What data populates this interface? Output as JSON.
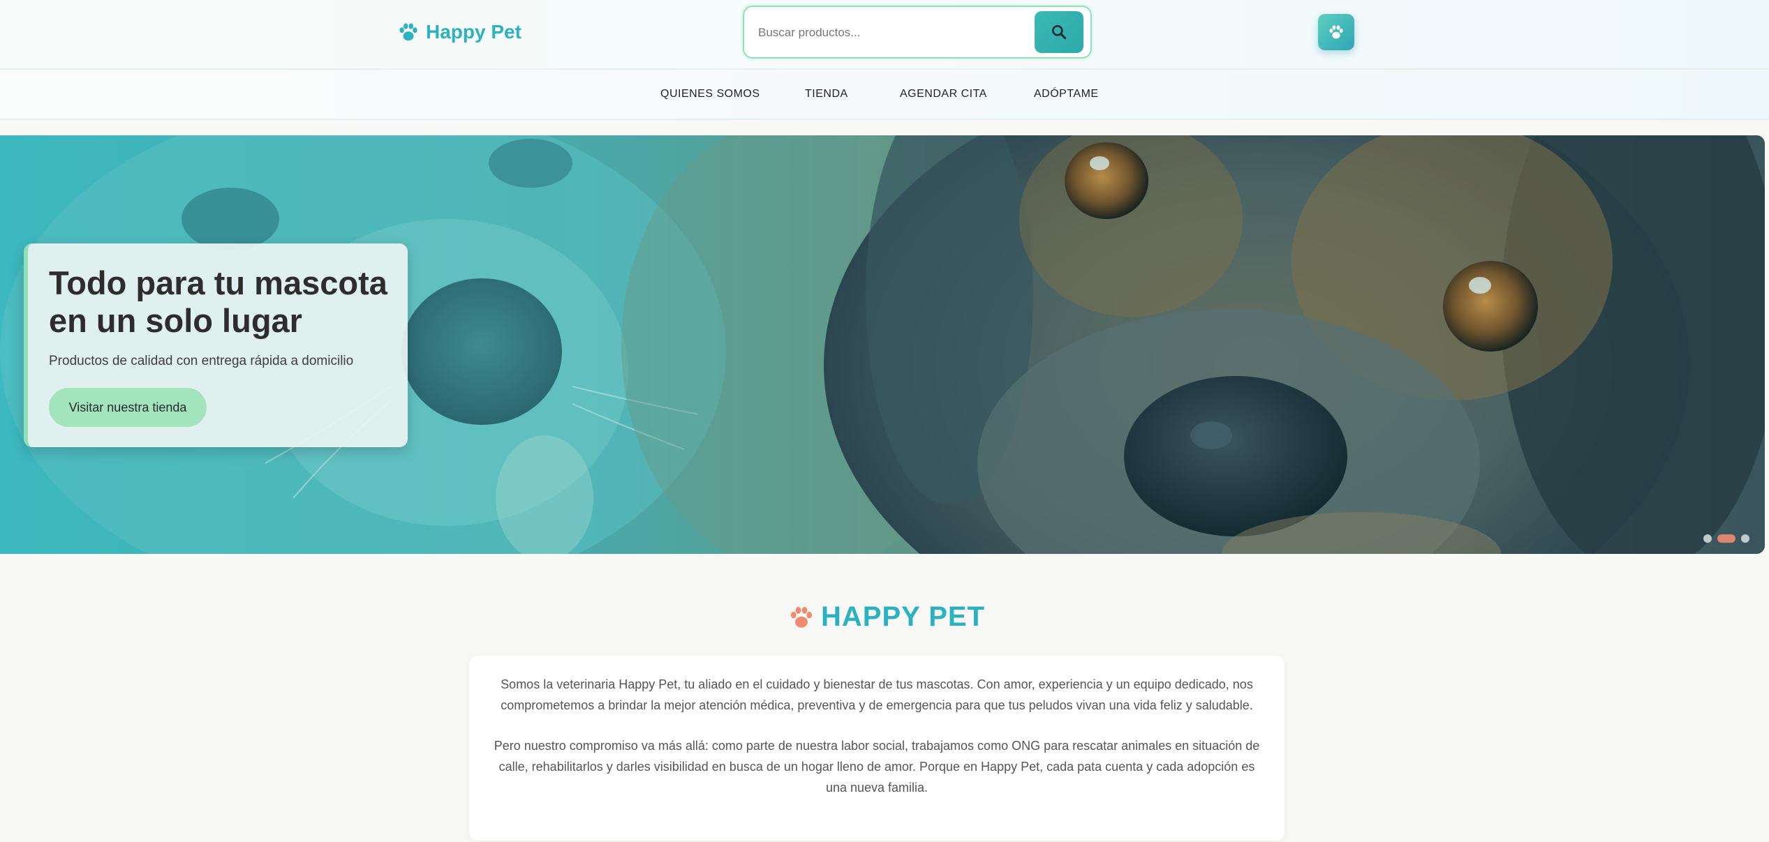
{
  "header": {
    "brand": "Happy Pet",
    "search_placeholder": "Buscar productos...",
    "colors": {
      "brand": "#2bb1bf",
      "search_border": "#8ee0bb",
      "search_button": "#2ea9a9"
    }
  },
  "nav": {
    "items": [
      "QUIENES SOMOS",
      "TIENDA",
      "AGENDAR CITA",
      "ADÓPTAME"
    ]
  },
  "hero": {
    "title": "Todo para tu mascota en un solo lugar",
    "subtitle": "Productos de calidad con entrega rápida a domicilio",
    "cta_label": "Visitar nuestra tienda",
    "slides": {
      "count": 3,
      "active_index": 1
    }
  },
  "about": {
    "heading": "HAPPY PET",
    "paragraphs": [
      "Somos la veterinaria Happy Pet, tu aliado en el cuidado y bienestar de tus mascotas. Con amor, experiencia y un equipo dedicado, nos comprometemos a brindar la mejor atención médica, preventiva y de emergencia para que tus peludos vivan una vida feliz y saludable.",
      "Pero nuestro compromiso va más allá: como parte de nuestra labor social, trabajamos como ONG para rescatar animales en situación de calle, rehabilitarlos y darles visibilidad en busca de un hogar lleno de amor. Porque en Happy Pet, cada pata cuenta y cada adopción es una nueva familia."
    ],
    "colors": {
      "heading": "#2bb1bf",
      "paw": "#f08b72"
    }
  },
  "icons": [
    "paw-icon",
    "search-icon"
  ]
}
